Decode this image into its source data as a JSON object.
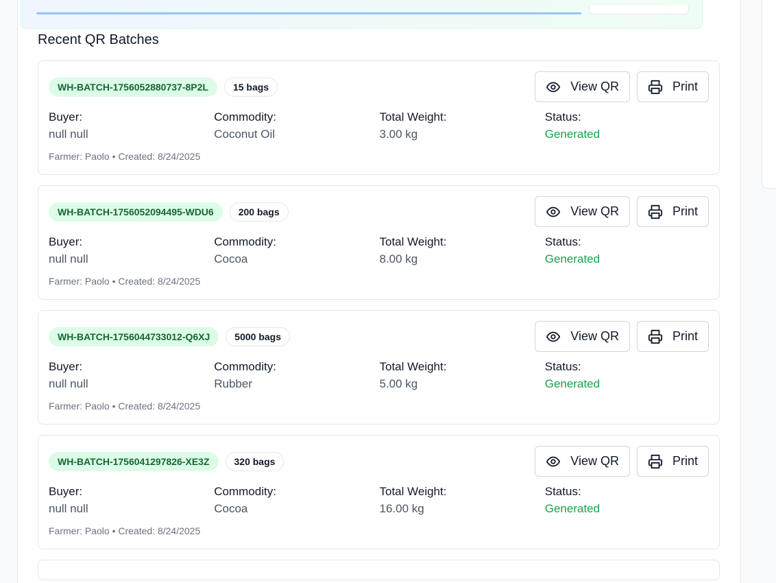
{
  "section": {
    "title": "Recent QR Batches"
  },
  "labels": {
    "buyer": "Buyer:",
    "commodity": "Commodity:",
    "total_weight": "Total Weight:",
    "status": "Status:",
    "view_qr": "View QR",
    "print": "Print"
  },
  "colors": {
    "batch_badge_bg": "#dcfce7",
    "batch_badge_text": "#166534",
    "status_generated": "#16a34a"
  },
  "icons": {
    "view": "eye-icon",
    "print": "printer-icon"
  },
  "batches": [
    {
      "id": "WH-BATCH-1756052880737-8P2L",
      "bags": "15 bags",
      "buyer": "null null",
      "commodity": "Coconut Oil",
      "total_weight": "3.00 kg",
      "status": "Generated",
      "meta": "Farmer: Paolo • Created: 8/24/2025"
    },
    {
      "id": "WH-BATCH-1756052094495-WDU6",
      "bags": "200 bags",
      "buyer": "null null",
      "commodity": "Cocoa",
      "total_weight": "8.00 kg",
      "status": "Generated",
      "meta": "Farmer: Paolo • Created: 8/24/2025"
    },
    {
      "id": "WH-BATCH-1756044733012-Q6XJ",
      "bags": "5000 bags",
      "buyer": "null null",
      "commodity": "Rubber",
      "total_weight": "5.00 kg",
      "status": "Generated",
      "meta": "Farmer: Paolo • Created: 8/24/2025"
    },
    {
      "id": "WH-BATCH-1756041297826-XE3Z",
      "bags": "320 bags",
      "buyer": "null null",
      "commodity": "Cocoa",
      "total_weight": "16.00 kg",
      "status": "Generated",
      "meta": "Farmer: Paolo • Created: 8/24/2025"
    }
  ]
}
